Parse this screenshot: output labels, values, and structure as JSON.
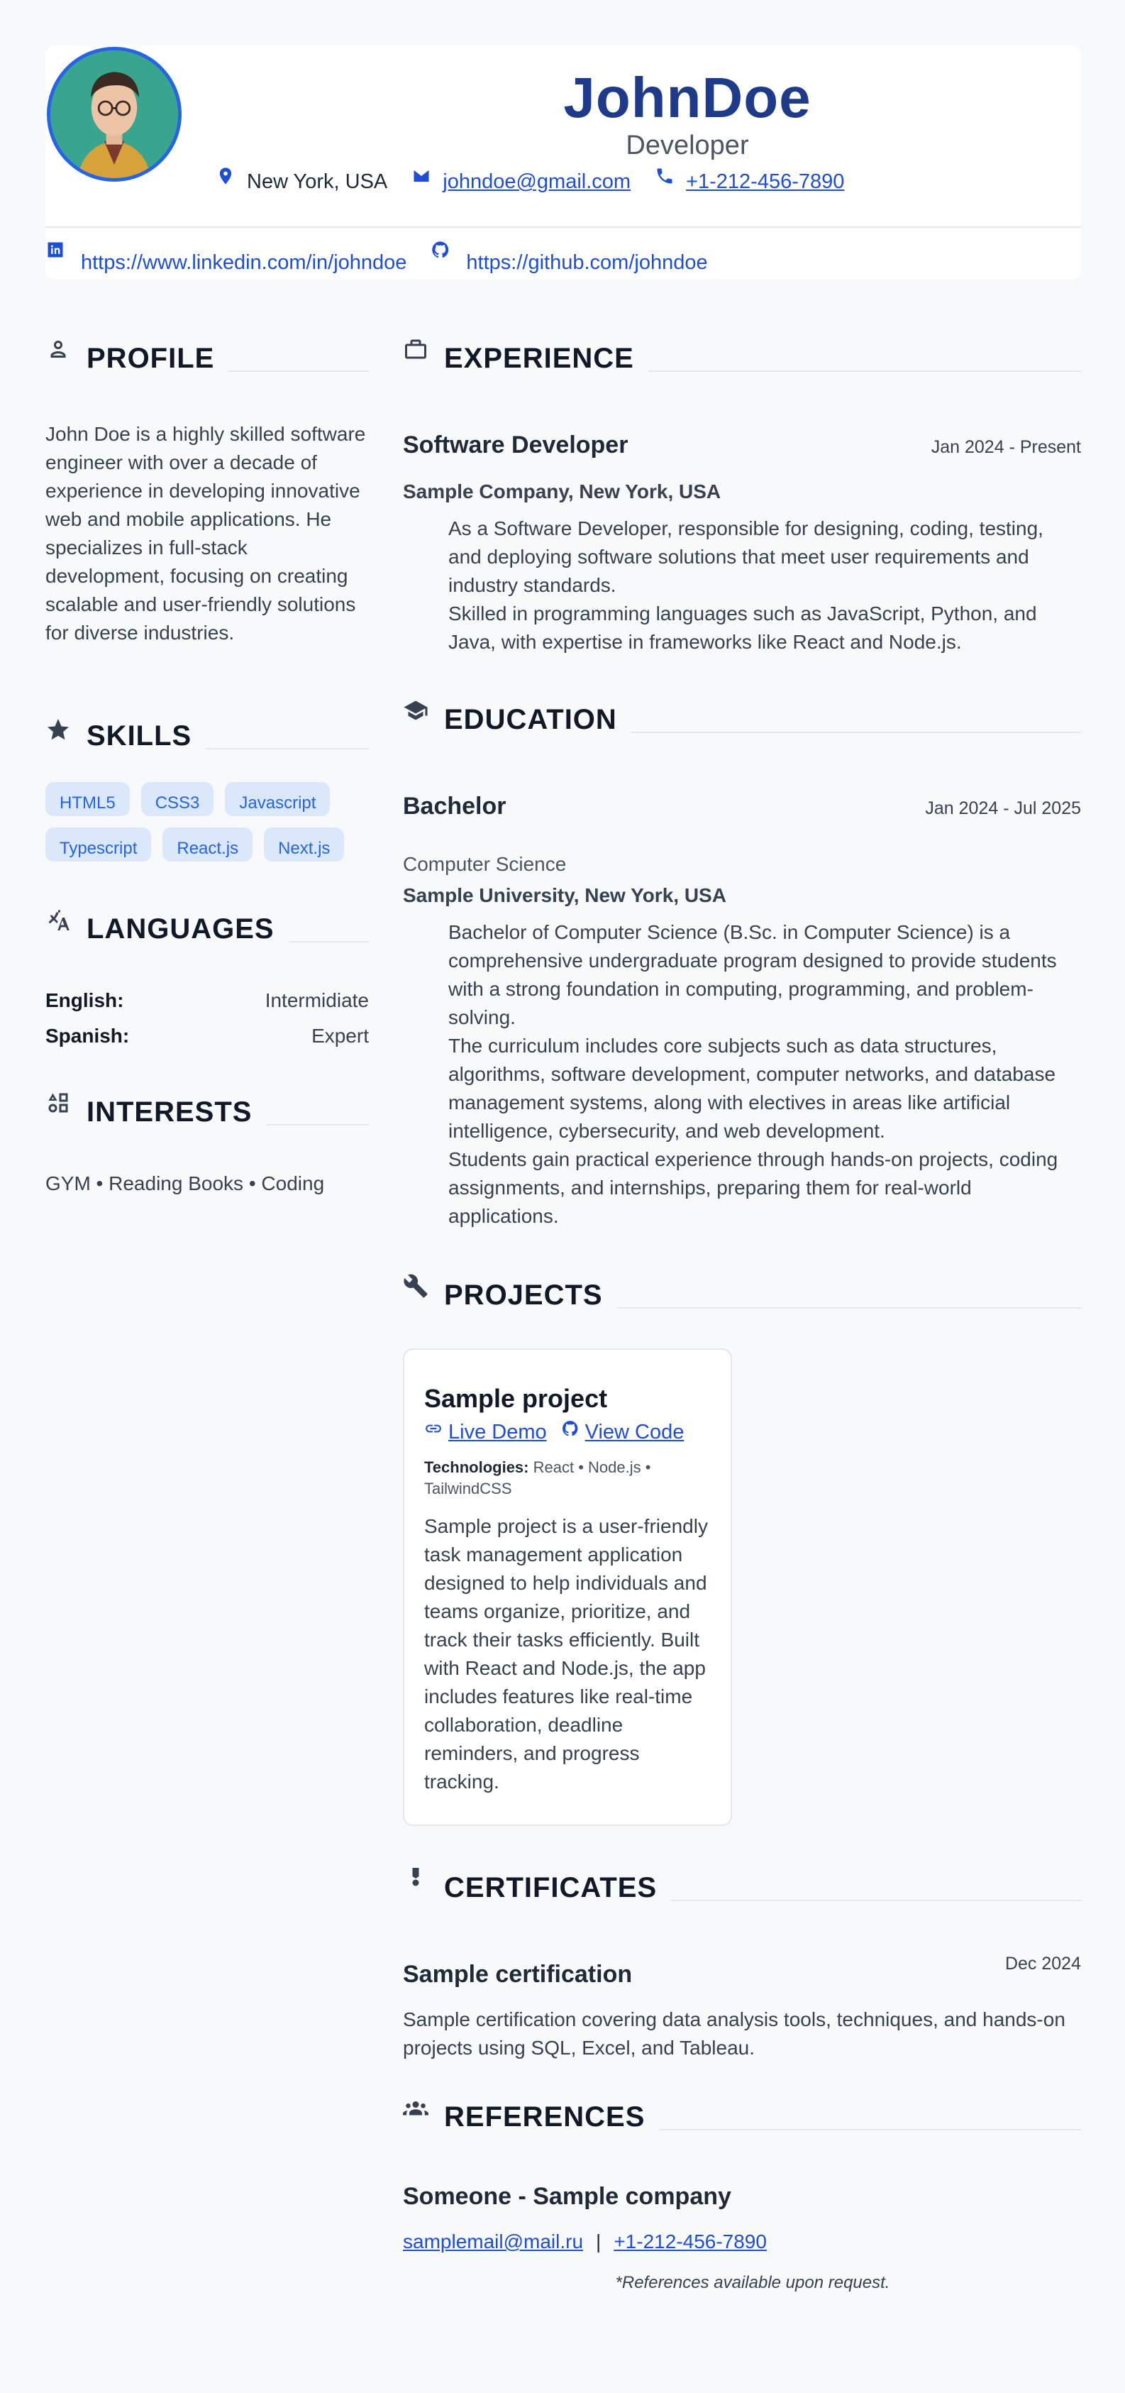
{
  "header": {
    "name": "JohnDoe",
    "title": "Developer",
    "location": "New York, USA",
    "email": "johndoe@gmail.com",
    "phone": "+1-212-456-7890",
    "linkedin": "https://www.linkedin.com/in/johndoe",
    "github": "https://github.com/johndoe"
  },
  "profile": {
    "heading": "PROFILE",
    "text": "John Doe is a highly skilled software engineer with over a decade of experience in developing innovative web and mobile applications. He specializes in full-stack development, focusing on creating scalable and user-friendly solutions for diverse industries."
  },
  "skills": {
    "heading": "SKILLS",
    "items": [
      "HTML5",
      "CSS3",
      "Javascript",
      "Typescript",
      "React.js",
      "Next.js"
    ]
  },
  "languages": {
    "heading": "LANGUAGES",
    "items": [
      {
        "name": "English:",
        "level": "Intermidiate"
      },
      {
        "name": "Spanish:",
        "level": "Expert"
      }
    ]
  },
  "interests": {
    "heading": "INTERESTS",
    "text": "GYM • Reading Books • Coding"
  },
  "experience": {
    "heading": "EXPERIENCE",
    "role": "Software Developer",
    "dates": "Jan 2024 - Present",
    "company": "Sample Company, New York, USA",
    "bullets": [
      "As a Software Developer, responsible for designing, coding, testing, and deploying software solutions that meet user requirements and industry standards.",
      "Skilled in programming languages such as JavaScript, Python, and Java, with expertise in frameworks like React and Node.js."
    ]
  },
  "education": {
    "heading": "EDUCATION",
    "degree": "Bachelor",
    "dates": "Jan 2024 - Jul 2025",
    "field": "Computer Science",
    "school": "Sample University, New York, USA",
    "bullets": [
      "Bachelor of Computer Science (B.Sc. in Computer Science) is a comprehensive undergraduate program designed to provide students with a strong foundation in computing, programming, and problem-solving.",
      "The curriculum includes core subjects such as data structures, algorithms, software development, computer networks, and database management systems, along with electives in areas like artificial intelligence, cybersecurity, and web development.",
      "Students gain practical experience through hands-on projects, coding assignments, and internships, preparing them for real-world applications."
    ]
  },
  "projects": {
    "heading": "PROJECTS",
    "title": "Sample project",
    "live_demo": "Live Demo",
    "view_code": "View Code",
    "tech_label": "Technologies:",
    "tech": "React • Node.js • TailwindCSS",
    "description": "Sample project is a user-friendly task management application designed to help individuals and teams organize, prioritize, and track their tasks efficiently. Built with React and Node.js, the app includes features like real-time collaboration, deadline reminders, and progress tracking."
  },
  "certificates": {
    "heading": "CERTIFICATES",
    "title": "Sample certification",
    "date": "Dec 2024",
    "description": "Sample certification covering data analysis tools, techniques, and hands-on projects using SQL, Excel, and Tableau."
  },
  "references": {
    "heading": "REFERENCES",
    "name": "Someone - Sample company",
    "email": "samplemail@mail.ru",
    "separator": "|",
    "phone": "+1-212-456-7890",
    "note": "*References available upon request."
  },
  "colors": {
    "accent": "#1d4ed8",
    "name": "#1e3a8a",
    "chip_bg": "#dbe7fb",
    "background": "#f7f9fb"
  }
}
